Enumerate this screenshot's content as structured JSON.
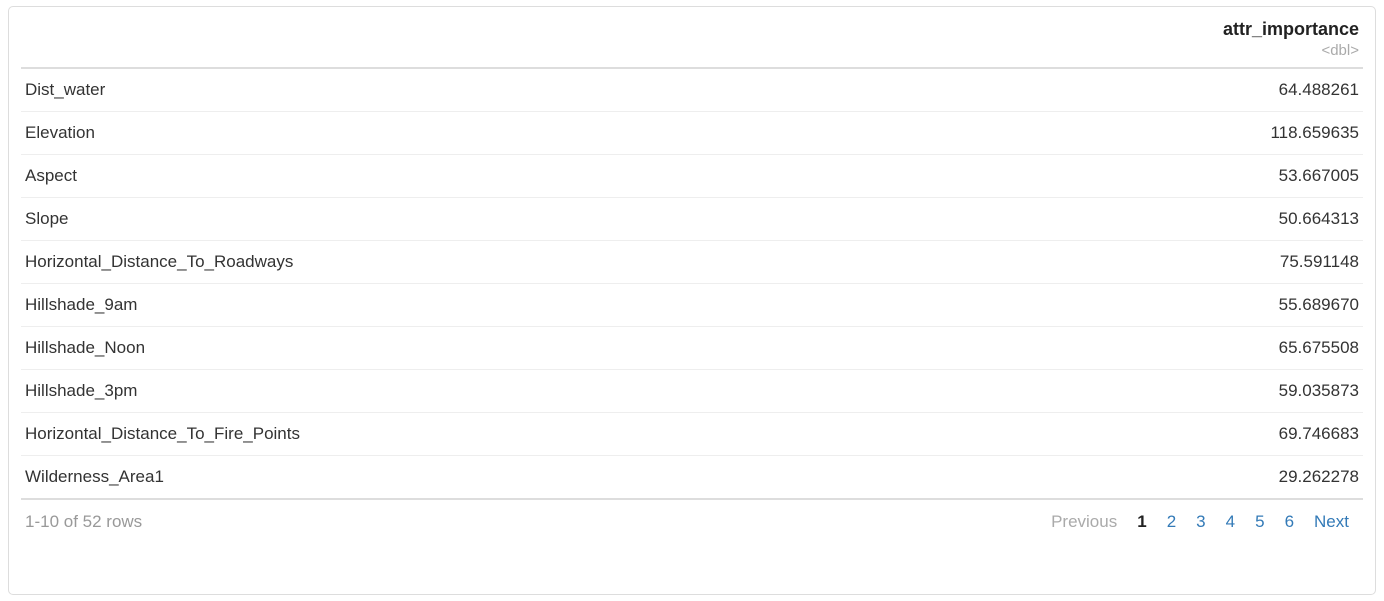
{
  "header": {
    "row_label_col": "",
    "value_col": "attr_importance",
    "value_type": "<dbl>"
  },
  "rows": [
    {
      "name": "Dist_water",
      "value": "64.488261"
    },
    {
      "name": "Elevation",
      "value": "118.659635"
    },
    {
      "name": "Aspect",
      "value": "53.667005"
    },
    {
      "name": "Slope",
      "value": "50.664313"
    },
    {
      "name": "Horizontal_Distance_To_Roadways",
      "value": "75.591148"
    },
    {
      "name": "Hillshade_9am",
      "value": "55.689670"
    },
    {
      "name": "Hillshade_Noon",
      "value": "65.675508"
    },
    {
      "name": "Hillshade_3pm",
      "value": "59.035873"
    },
    {
      "name": "Horizontal_Distance_To_Fire_Points",
      "value": "69.746683"
    },
    {
      "name": "Wilderness_Area1",
      "value": "29.262278"
    }
  ],
  "footer": {
    "status": "1-10 of 52 rows",
    "pager": {
      "prev": "Previous",
      "next": "Next",
      "pages": [
        "1",
        "2",
        "3",
        "4",
        "5",
        "6"
      ],
      "current": "1"
    }
  },
  "colors": {
    "link": "#337ab7",
    "muted": "#999",
    "border": "#ddd"
  }
}
